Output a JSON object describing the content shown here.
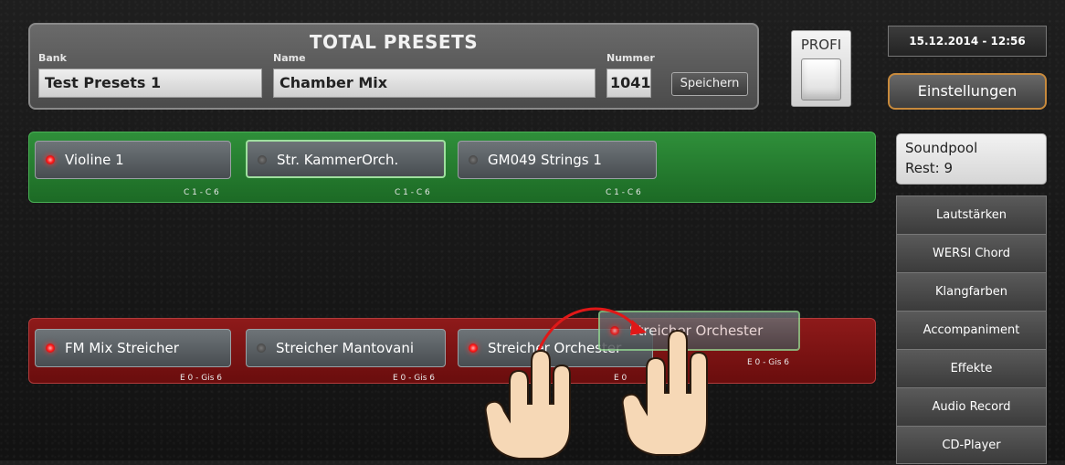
{
  "header": {
    "title": "TOTAL PRESETS",
    "bank_label": "Bank",
    "bank_value": "Test Presets 1",
    "name_label": "Name",
    "name_value": "Chamber Mix",
    "nummer_label": "Nummer",
    "nummer_value": "1041",
    "save_label": "Speichern"
  },
  "profi_label": "PROFI",
  "datetime": "15.12.2014 - 12:56",
  "einstellungen_label": "Einstellungen",
  "soundpool": {
    "line1": "Soundpool",
    "line2": "Rest: 9"
  },
  "menu": [
    "Lautstärken",
    "WERSI Chord",
    "Klangfarben",
    "Accompaniment",
    "Effekte",
    "Audio Record",
    "CD-Player"
  ],
  "upper_layer": [
    {
      "label": "Violine 1",
      "range": "C 1 - C 6",
      "led": "on"
    },
    {
      "label": "Str. KammerOrch.",
      "range": "C 1 - C 6",
      "led": "off"
    },
    {
      "label": "GM049 Strings 1",
      "range": "C 1 - C 6",
      "led": "off"
    }
  ],
  "lower_layer": [
    {
      "label": "FM Mix Streicher",
      "range": "E 0 - Gis 6",
      "led": "on"
    },
    {
      "label": "Streicher Mantovani",
      "range": "E 0 - Gis 6",
      "led": "off"
    },
    {
      "label": "Streicher Orchester",
      "range": "E 0",
      "led": "on"
    }
  ],
  "dragged": {
    "label": "Streicher Orchester",
    "range": "E 0 - Gis 6"
  },
  "colors": {
    "upper_layer": "#2f8f3a",
    "lower_layer": "#8e1a1a",
    "accent": "#c88a3c"
  },
  "icons": [
    "hand-touch-icon",
    "drag-arrow-icon"
  ]
}
